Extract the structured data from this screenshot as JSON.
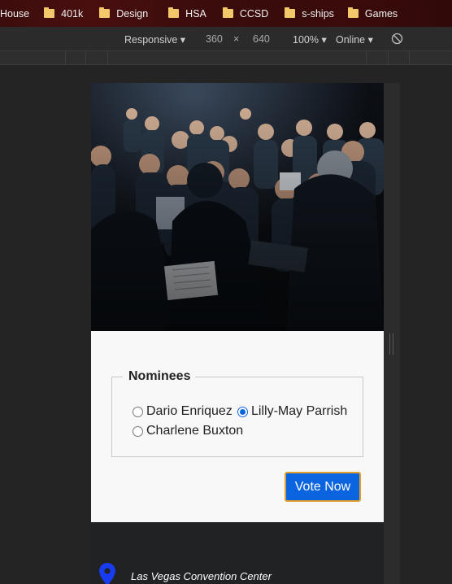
{
  "bookmarks": [
    {
      "label": "House",
      "folder": false
    },
    {
      "label": "401k",
      "folder": true
    },
    {
      "label": "Design",
      "folder": true
    },
    {
      "label": "HSA",
      "folder": true
    },
    {
      "label": "CCSD",
      "folder": true
    },
    {
      "label": "s-ships",
      "folder": true
    },
    {
      "label": "Games",
      "folder": true
    }
  ],
  "devtools": {
    "device": "Responsive",
    "width": "360",
    "times": "×",
    "height": "640",
    "zoom": "100%",
    "network": "Online"
  },
  "form": {
    "legend": "Nominees",
    "options": [
      {
        "label": "Dario Enriquez",
        "checked": false
      },
      {
        "label": "Lilly-May Parrish",
        "checked": true
      },
      {
        "label": "Charlene Buxton",
        "checked": false
      }
    ],
    "submit": "Vote Now"
  },
  "footer": {
    "location": "Las Vegas Convention Center"
  },
  "colors": {
    "accent": "#0a64e0",
    "button_border": "#e0a030",
    "pin": "#1a3cf0"
  }
}
